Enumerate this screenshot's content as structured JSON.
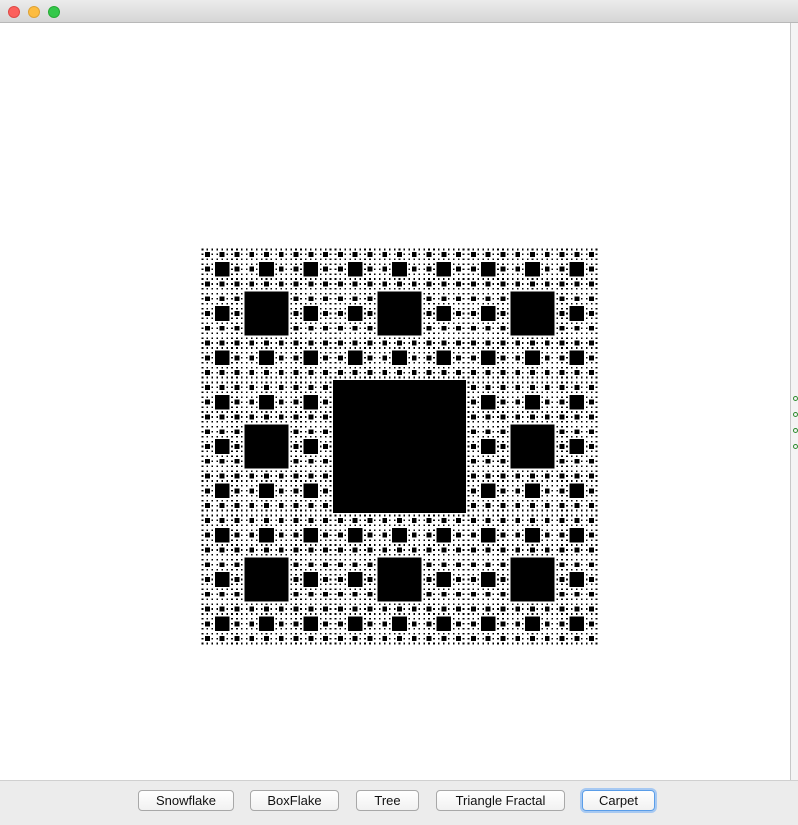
{
  "window": {
    "title": ""
  },
  "buttons": {
    "snowflake": "Snowflake",
    "boxflake": "BoxFlake",
    "tree": "Tree",
    "triangle_fractal": "Triangle Fractal",
    "carpet": "Carpet"
  },
  "selected_button": "Carpet",
  "fractal": {
    "type": "Sierpinski carpet",
    "depth": 5,
    "fill_color": "#000000",
    "background_color": "#ffffff"
  },
  "colors": {
    "focus_ring": "#5a9de8",
    "close": "#fc605c",
    "minimize": "#fdbc40",
    "zoom": "#34c84a"
  }
}
